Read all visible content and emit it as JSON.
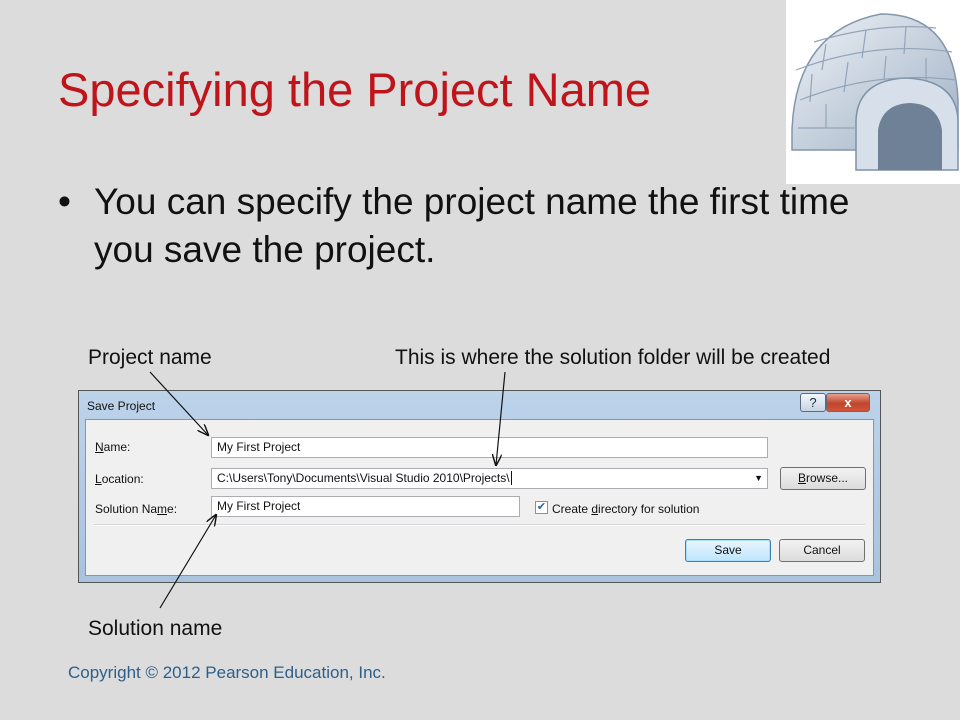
{
  "slide": {
    "title": "Specifying the Project Name",
    "bullet_marker": "•",
    "bullet_text": "You can specify the project name the first time you save the project.",
    "copyright": "Copyright © 2012 Pearson Education, Inc.",
    "title_color": "#c0141b",
    "decoration_icon": "igloo-icon"
  },
  "callouts": {
    "project_name": "Project name",
    "location": "This is where the solution folder will be created",
    "solution_name": "Solution name"
  },
  "dialog": {
    "title": "Save Project",
    "help_button": "?",
    "close_button": "x",
    "name_label_pre": "",
    "name_label_key": "N",
    "name_label_post": "ame:",
    "name_value": "My First Project",
    "location_label_pre": "",
    "location_label_key": "L",
    "location_label_post": "ocation:",
    "location_value": "C:\\Users\\Tony\\Documents\\Visual Studio 2010\\Projects\\",
    "solution_label_pre": "Solution Na",
    "solution_label_key": "m",
    "solution_label_post": "e:",
    "solution_value": "My First Project",
    "browse_pre": "",
    "browse_key": "B",
    "browse_post": "rowse...",
    "create_dir_pre": "Create ",
    "create_dir_key": "d",
    "create_dir_post": "irectory for solution",
    "create_dir_checked": true,
    "save_label": "Save",
    "cancel_label": "Cancel"
  }
}
